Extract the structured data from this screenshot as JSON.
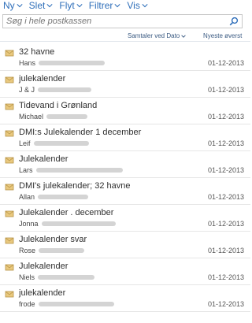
{
  "toolbar": {
    "items": [
      {
        "label": "Ny"
      },
      {
        "label": "Slet"
      },
      {
        "label": "Flyt"
      },
      {
        "label": "Filtrer"
      },
      {
        "label": "Vis"
      }
    ]
  },
  "search": {
    "placeholder": "Søg i hele postkassen"
  },
  "sort": {
    "group_label": "Samtaler ved Dato",
    "order_label": "Nyeste øverst"
  },
  "emails": [
    {
      "subject": "32 havne",
      "sender": "Hans",
      "date": "01-12-2013"
    },
    {
      "subject": "julekalender",
      "sender": "J & J",
      "date": "01-12-2013"
    },
    {
      "subject": "Tidevand i Grønland",
      "sender": "Michael",
      "date": "01-12-2013"
    },
    {
      "subject": "DMI:s Julekalender 1 december",
      "sender": "Leif",
      "date": "01-12-2013"
    },
    {
      "subject": "Julekalender",
      "sender": "Lars",
      "date": "01-12-2013"
    },
    {
      "subject": "DMI's julekalender; 32 havne",
      "sender": "Allan",
      "date": "01-12-2013"
    },
    {
      "subject": "Julekalender . december",
      "sender": "Jonna",
      "date": "01-12-2013"
    },
    {
      "subject": "Julekalender svar",
      "sender": "Rose",
      "date": "01-12-2013"
    },
    {
      "subject": "Julekalender",
      "sender": "Niels",
      "date": "01-12-2013"
    },
    {
      "subject": "julekalender",
      "sender": "frode",
      "date": "01-12-2013"
    }
  ],
  "colors": {
    "accent": "#2f6fba"
  },
  "icons": {
    "mail": "envelope-icon",
    "search": "search-icon",
    "dropdown": "chevron-down-icon"
  }
}
